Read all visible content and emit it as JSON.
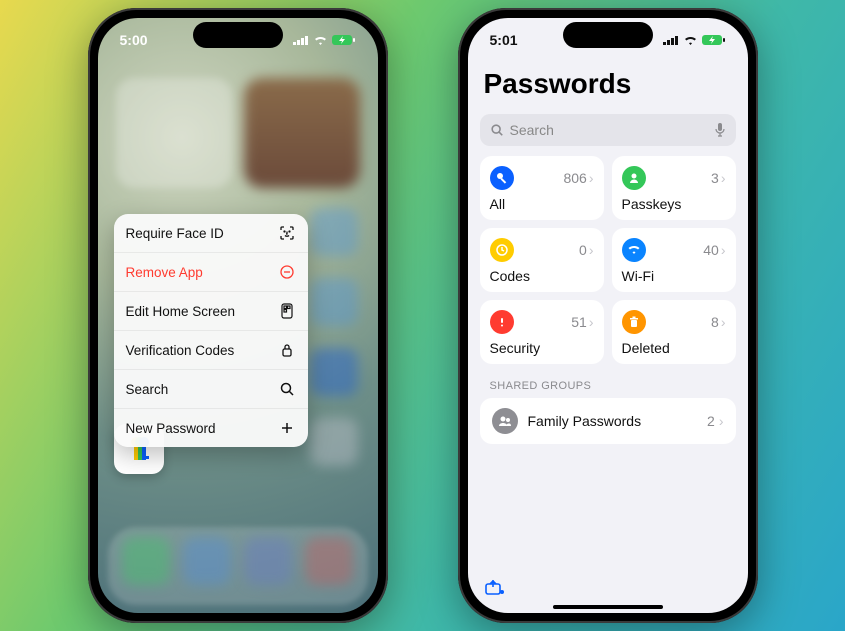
{
  "phone1": {
    "time": "5:00",
    "menu": [
      {
        "label": "Require Face ID",
        "icon": "faceid"
      },
      {
        "label": "Remove App",
        "icon": "remove",
        "destructive": true
      },
      {
        "label": "Edit Home Screen",
        "icon": "edit"
      },
      {
        "label": "Verification Codes",
        "icon": "lock"
      },
      {
        "label": "Search",
        "icon": "search"
      },
      {
        "label": "New Password",
        "icon": "plus"
      }
    ],
    "app_icon_name": "Passwords"
  },
  "phone2": {
    "time": "5:01",
    "title": "Passwords",
    "search_placeholder": "Search",
    "cards": [
      {
        "label": "All",
        "count": 806,
        "color": "#0a60ff",
        "icon": "key"
      },
      {
        "label": "Passkeys",
        "count": 3,
        "color": "#34c759",
        "icon": "person"
      },
      {
        "label": "Codes",
        "count": 0,
        "color": "#ffcc00",
        "icon": "clock"
      },
      {
        "label": "Wi-Fi",
        "count": 40,
        "color": "#0a84ff",
        "icon": "wifi"
      },
      {
        "label": "Security",
        "count": 51,
        "color": "#ff3b30",
        "icon": "alert"
      },
      {
        "label": "Deleted",
        "count": 8,
        "color": "#ff9500",
        "icon": "trash"
      }
    ],
    "shared_groups_label": "SHARED GROUPS",
    "groups": [
      {
        "label": "Family Passwords",
        "count": 2
      }
    ]
  }
}
